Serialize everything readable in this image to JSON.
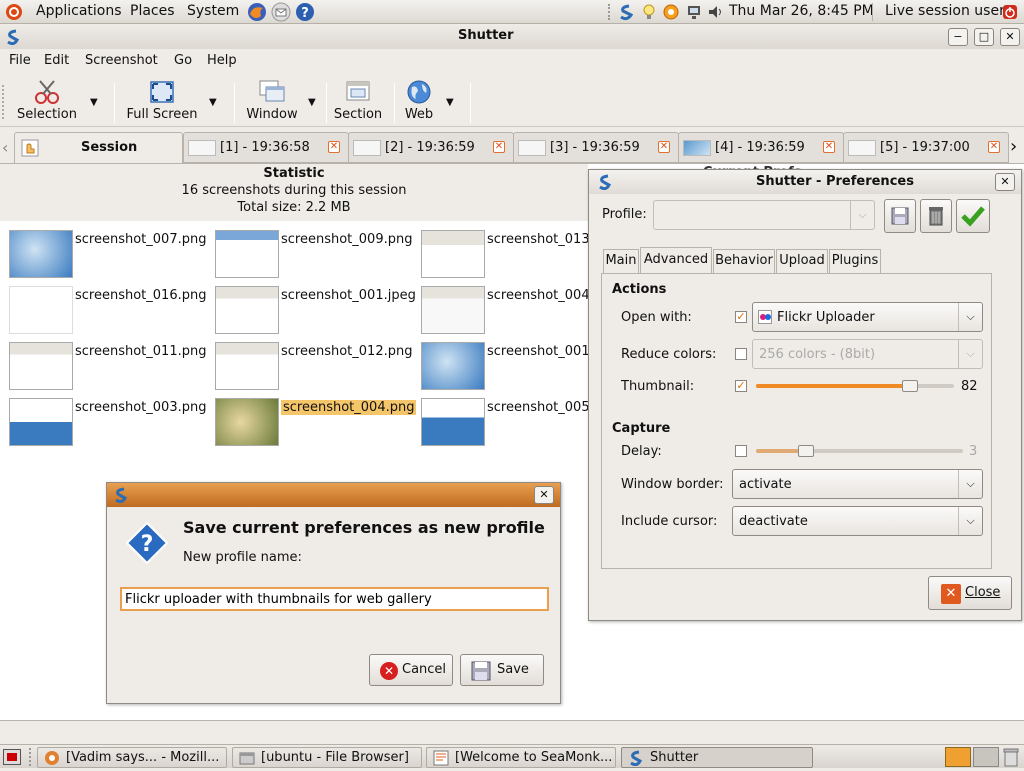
{
  "top_panel": {
    "menus": [
      "Applications",
      "Places",
      "System"
    ],
    "clock": "Thu Mar 26,  8:45 PM",
    "user": "Live session user"
  },
  "window": {
    "title": "Shutter",
    "menu": [
      "File",
      "Edit",
      "Screenshot",
      "Go",
      "Help"
    ],
    "toolbar": {
      "selection": "Selection",
      "fullscreen": "Full Screen",
      "window": "Window",
      "section": "Section",
      "web": "Web"
    },
    "tabs": [
      {
        "label": "Session"
      },
      {
        "label": "[1] - 19:36:58"
      },
      {
        "label": "[2] - 19:36:59"
      },
      {
        "label": "[3] - 19:36:59"
      },
      {
        "label": "[4] - 19:36:59"
      },
      {
        "label": "[5] - 19:37:00"
      }
    ],
    "statistic": {
      "title": "Statistic",
      "count": "16 screenshots during this session",
      "size": "Total size: 2.2 MB"
    },
    "thumbnails": [
      "screenshot_007.png",
      "screenshot_009.png",
      "screenshot_013",
      "screenshot_016.png",
      "screenshot_001.jpeg",
      "screenshot_004",
      "screenshot_011.png",
      "screenshot_012.png",
      "screenshot_001",
      "screenshot_003.png",
      "screenshot_004.png",
      "screenshot_005"
    ],
    "bg_partial_text": "Current Prefs"
  },
  "preferences": {
    "title": "Shutter - Preferences",
    "profile_label": "Profile:",
    "tabs": [
      "Main",
      "Advanced",
      "Behavior",
      "Upload",
      "Plugins"
    ],
    "actions_header": "Actions",
    "open_with_label": "Open with:",
    "open_with_value": "Flickr Uploader",
    "reduce_colors_label": "Reduce colors:",
    "reduce_colors_value": "256 colors  - (8bit)",
    "thumbnail_label": "Thumbnail:",
    "thumbnail_value": "82",
    "capture_header": "Capture",
    "delay_label": "Delay:",
    "delay_value": "3",
    "window_border_label": "Window border:",
    "window_border_value": "activate",
    "include_cursor_label": "Include cursor:",
    "include_cursor_value": "deactivate",
    "close_button": "Close",
    "thumbnail_fraction": 0.78,
    "delay_fraction": 0.24
  },
  "save_dialog": {
    "heading": "Save current preferences as new profile",
    "prompt": "New profile name:",
    "input_value": "Flickr uploader with thumbnails for web gallery",
    "cancel": "Cancel",
    "save": "Save"
  },
  "taskbar": [
    {
      "label": "[Vadim says... - Mozill..."
    },
    {
      "label": "[ubuntu - File Browser]"
    },
    {
      "label": "[Welcome to SeaMonk..."
    },
    {
      "label": "Shutter"
    }
  ],
  "colors": {
    "accent": "#f08a24",
    "dialog_title": "#d8863a",
    "selection": "#f5c56a"
  }
}
